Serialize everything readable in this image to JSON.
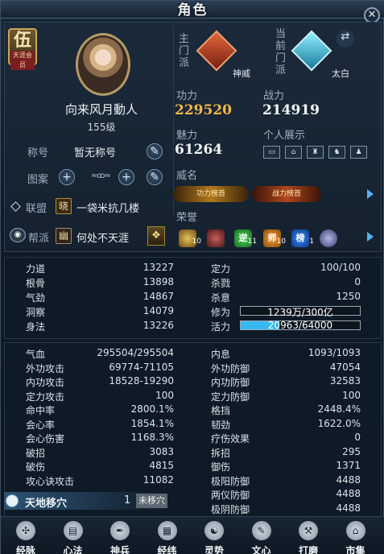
{
  "window": {
    "title": "角色"
  },
  "vip": {
    "big": "伍",
    "small": "天涯会员"
  },
  "player": {
    "name": "向来风月動人",
    "level": "155级"
  },
  "nickname": {
    "label": "称号",
    "value": "暂无称号"
  },
  "pattern": {
    "label": "图案",
    "plus1": "+",
    "plus2": "+"
  },
  "alliance": {
    "label": "联盟",
    "icon_char": "晓",
    "value": "一袋米抗几楼"
  },
  "guild": {
    "label": "帮派",
    "icon_char": "幽",
    "value": "何处不天涯"
  },
  "sect": {
    "main_label": "主门派",
    "main_name": "神威",
    "current_label": "当前门派",
    "current_name": "太白"
  },
  "stats": {
    "gongli_label": "功力",
    "gongli_value": "229520",
    "zhanli_label": "战力",
    "zhanli_value": "214919",
    "meili_label": "魅力",
    "meili_value": "61264",
    "display_label": "个人展示"
  },
  "fame": {
    "label": "威名",
    "title1": "功力榜首",
    "title2": "战力榜首"
  },
  "honor": {
    "label": "荣誉",
    "items": [
      {
        "char": "",
        "count": "10"
      },
      {
        "char": "",
        "count": ""
      },
      {
        "char": "逆",
        "count": "11"
      },
      {
        "char": "师",
        "count": "10"
      },
      {
        "char": "榜",
        "count": "1"
      },
      {
        "char": "",
        "count": ""
      }
    ]
  },
  "attrs_left": [
    {
      "name": "力道",
      "value": "13227"
    },
    {
      "name": "根骨",
      "value": "13898"
    },
    {
      "name": "气劲",
      "value": "14867"
    },
    {
      "name": "洞察",
      "value": "14079"
    },
    {
      "name": "身法",
      "value": "13226"
    }
  ],
  "attrs_right": [
    {
      "name": "定力",
      "value": "100/100"
    },
    {
      "name": "杀戮",
      "value": "0"
    },
    {
      "name": "杀意",
      "value": "1250"
    },
    {
      "name": "修为",
      "value": "1239万/300亿",
      "bar_fraction": 0.0004
    },
    {
      "name": "活力",
      "value": "20963/64000",
      "bar_fraction": 0.3275
    }
  ],
  "combat_left": [
    {
      "name": "气血",
      "value": "295504/295504"
    },
    {
      "name": "外功攻击",
      "value": "69774-71105"
    },
    {
      "name": "内功攻击",
      "value": "18528-19290"
    },
    {
      "name": "定力攻击",
      "value": "100"
    },
    {
      "name": "命中率",
      "value": "2800.1%"
    },
    {
      "name": "会心率",
      "value": "1854.1%"
    },
    {
      "name": "会心伤害",
      "value": "1168.3%"
    },
    {
      "name": "破招",
      "value": "3083"
    },
    {
      "name": "破伤",
      "value": "4815"
    },
    {
      "name": "攻心诀攻击",
      "value": "11082"
    }
  ],
  "combat_right": [
    {
      "name": "内息",
      "value": "1093/1093"
    },
    {
      "name": "外功防御",
      "value": "47054"
    },
    {
      "name": "内功防御",
      "value": "32583"
    },
    {
      "name": "定力防御",
      "value": "100"
    },
    {
      "name": "格挡",
      "value": "2448.4%"
    },
    {
      "name": "韧劲",
      "value": "1622.0%"
    },
    {
      "name": "疗伤效果",
      "value": "0"
    },
    {
      "name": "拆招",
      "value": "295"
    },
    {
      "name": "御伤",
      "value": "1371"
    },
    {
      "name": "极阳防御",
      "value": "4488"
    },
    {
      "name": "两仪防御",
      "value": "4488"
    },
    {
      "name": "极阴防御",
      "value": "4488"
    }
  ],
  "tiandi": {
    "label": "天地移穴",
    "count": "1",
    "status": "未移穴"
  },
  "nav": [
    {
      "label": "经脉",
      "icon": "meridian-icon",
      "glyph": "✣"
    },
    {
      "label": "心法",
      "icon": "book-icon",
      "glyph": "▤"
    },
    {
      "label": "神兵",
      "icon": "weapon-icon",
      "glyph": "✒"
    },
    {
      "label": "经纬",
      "icon": "grid-icon",
      "glyph": "▦"
    },
    {
      "label": "灵势",
      "icon": "spirit-icon",
      "glyph": "☯"
    },
    {
      "label": "文心",
      "icon": "brush-icon",
      "glyph": "✎"
    },
    {
      "label": "打磨",
      "icon": "hammer-icon",
      "glyph": "⚒"
    },
    {
      "label": "市集",
      "icon": "market-icon",
      "glyph": "⌂"
    }
  ],
  "colors": {
    "gongli": "#f2b84a",
    "accent": "#37b9ef"
  }
}
